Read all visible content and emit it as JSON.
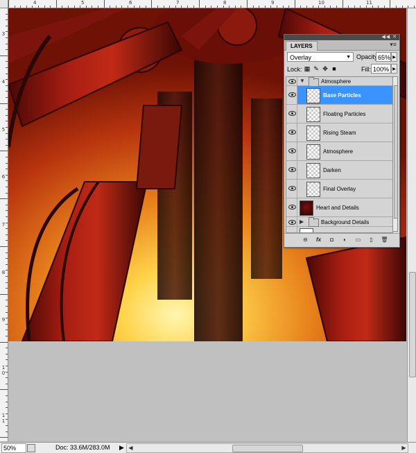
{
  "rulers": {
    "top_labels": [
      "4",
      "5",
      "6",
      "7",
      "8",
      "9",
      "10",
      "11"
    ],
    "left_labels": [
      "3",
      "4",
      "5",
      "6",
      "7",
      "8",
      "9",
      "10",
      "11"
    ]
  },
  "status_bar": {
    "zoom": "50%",
    "doc_info": "Doc: 33.6M/283.0M",
    "arrow": "▶",
    "scroll_left": "◀",
    "scroll_right": "▶"
  },
  "layers_panel": {
    "tab": "LAYERS",
    "collapse_glyph": "◀◀ ✕",
    "menu_glyph": "▾≡",
    "blend_mode": "Overlay",
    "opacity_label": "Opacity:",
    "opacity": "65%",
    "lock_label": "Lock:",
    "fill_label": "Fill:",
    "fill": "100%",
    "layers": [
      {
        "name": "Atmosphere",
        "kind": "group",
        "expanded": true,
        "selected": false
      },
      {
        "name": "Base Particles",
        "kind": "layer",
        "selected": true
      },
      {
        "name": "Floating Particles",
        "kind": "layer",
        "selected": false
      },
      {
        "name": "Rising Steam",
        "kind": "layer",
        "selected": false
      },
      {
        "name": "Atmosphere",
        "kind": "layer",
        "selected": false
      },
      {
        "name": "Darken",
        "kind": "layer",
        "selected": false
      },
      {
        "name": "Final Overlay",
        "kind": "layer",
        "selected": false
      },
      {
        "name": "Heart and Details",
        "kind": "art-layer",
        "selected": false
      },
      {
        "name": "Background Details",
        "kind": "group",
        "expanded": false,
        "selected": false
      }
    ],
    "footer_icons": [
      "link-icon",
      "fx-icon",
      "mask-icon",
      "adjustment-icon",
      "new-group-icon",
      "new-layer-icon",
      "trash-icon"
    ],
    "footer_glyphs": [
      "⊖",
      "fx",
      "◘",
      "◐",
      "▭",
      "▯",
      "🗑"
    ]
  },
  "colors": {
    "selected_row": "#3a93ff",
    "panel_bg": "#d6d6d6",
    "pasteboard": "#c0c0c0"
  }
}
